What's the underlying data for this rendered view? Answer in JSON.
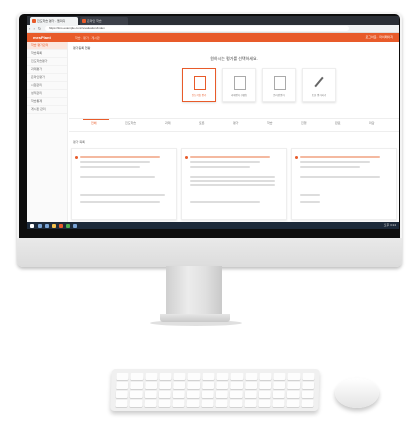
{
  "screen": {
    "tabs": [
      "진도학습 평가 - 엠피디",
      "온라인 학습"
    ],
    "url": "https://lms.example.co.kr/evaluation/index",
    "app_logo": "mesPlant",
    "header_menu": "학습 · 평가 · 게시판",
    "header_user": "로그아웃  ·  마이페이지",
    "sidebar_items": [
      "학습 평가관리",
      "학습목록",
      "진도학습평가",
      "과제평가",
      "온라인평가",
      "시험관리",
      "성적관리",
      "학습통계",
      "게시판 관리"
    ],
    "breadcrumb": "평가등록 현황",
    "heading": "원하시는 평가를 선택하세요.",
    "options": [
      "진도학습 평가",
      "과제평가 (개인)",
      "온라인평가",
      "토론 평가하기"
    ],
    "filter_tabs": [
      "전체",
      "진도학습",
      "과제",
      "토론",
      "평가",
      "학습",
      "진행",
      "완료",
      "마감"
    ],
    "section_title": "평가 목록",
    "clock": "오후 3:24"
  },
  "colors": {
    "accent": "#e85b2a",
    "taskbar": "#1d2a3a"
  }
}
